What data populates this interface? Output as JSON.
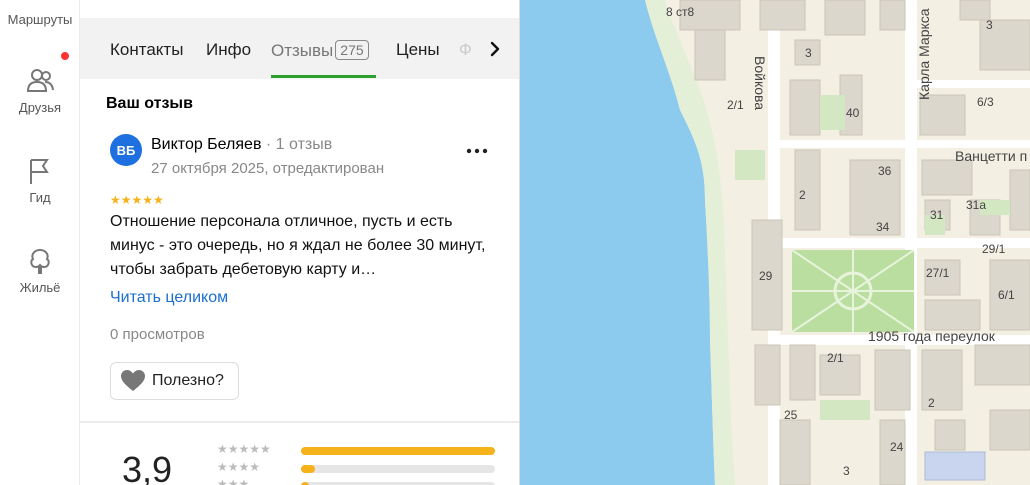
{
  "rail": {
    "items": [
      {
        "label": "Маршруты"
      },
      {
        "label": "Друзья"
      },
      {
        "label": "Гид"
      },
      {
        "label": "Жильё"
      }
    ]
  },
  "tabs": {
    "items": [
      {
        "label": "Контакты"
      },
      {
        "label": "Инфо"
      },
      {
        "label": "Отзывы",
        "count": "275",
        "active": true
      },
      {
        "label": "Цены"
      }
    ],
    "faded": "Ф"
  },
  "review": {
    "section_title": "Ваш отзыв",
    "avatar_initials": "ВБ",
    "author_name": "Виктор Беляев",
    "author_meta": " · 1 отзыв",
    "date": "27 октября 2025, отредактирован",
    "stars": "★★★★★",
    "rating": 5,
    "text": "Отношение персонала отличное, пусть и есть минус - это очередь, но я ждал не более 30 минут, чтобы забрать дебетовую карту и…",
    "read_more": "Читать целиком",
    "views": "0 просмотров",
    "useful_label": "Полезно?"
  },
  "rating_summary": {
    "average": "3,9",
    "rows": [
      {
        "stars": "★★★★★",
        "fraction": 1.0
      },
      {
        "stars": "★★★★",
        "fraction": 0.07
      },
      {
        "stars": "★★★",
        "fraction": 0.04
      }
    ]
  },
  "map": {
    "streets": [
      "Войкова",
      "Карла Маркса",
      "Ванцетти п",
      "1905 года переулок"
    ],
    "house_numbers": [
      "8 ст8",
      "3",
      "3",
      "2/1",
      "40",
      "6/3",
      "36",
      "2",
      "34",
      "31",
      "31а",
      "29/1",
      "29",
      "27/1",
      "6/1",
      "2/1",
      "2",
      "25",
      "24",
      "3"
    ]
  },
  "colors": {
    "accent_green": "#2ea02e",
    "link_blue": "#1b6fd0",
    "star_yellow": "#f5b21b",
    "avatar_blue": "#1e6fe0",
    "water": "#8ccbed",
    "land": "#f3efe3"
  }
}
